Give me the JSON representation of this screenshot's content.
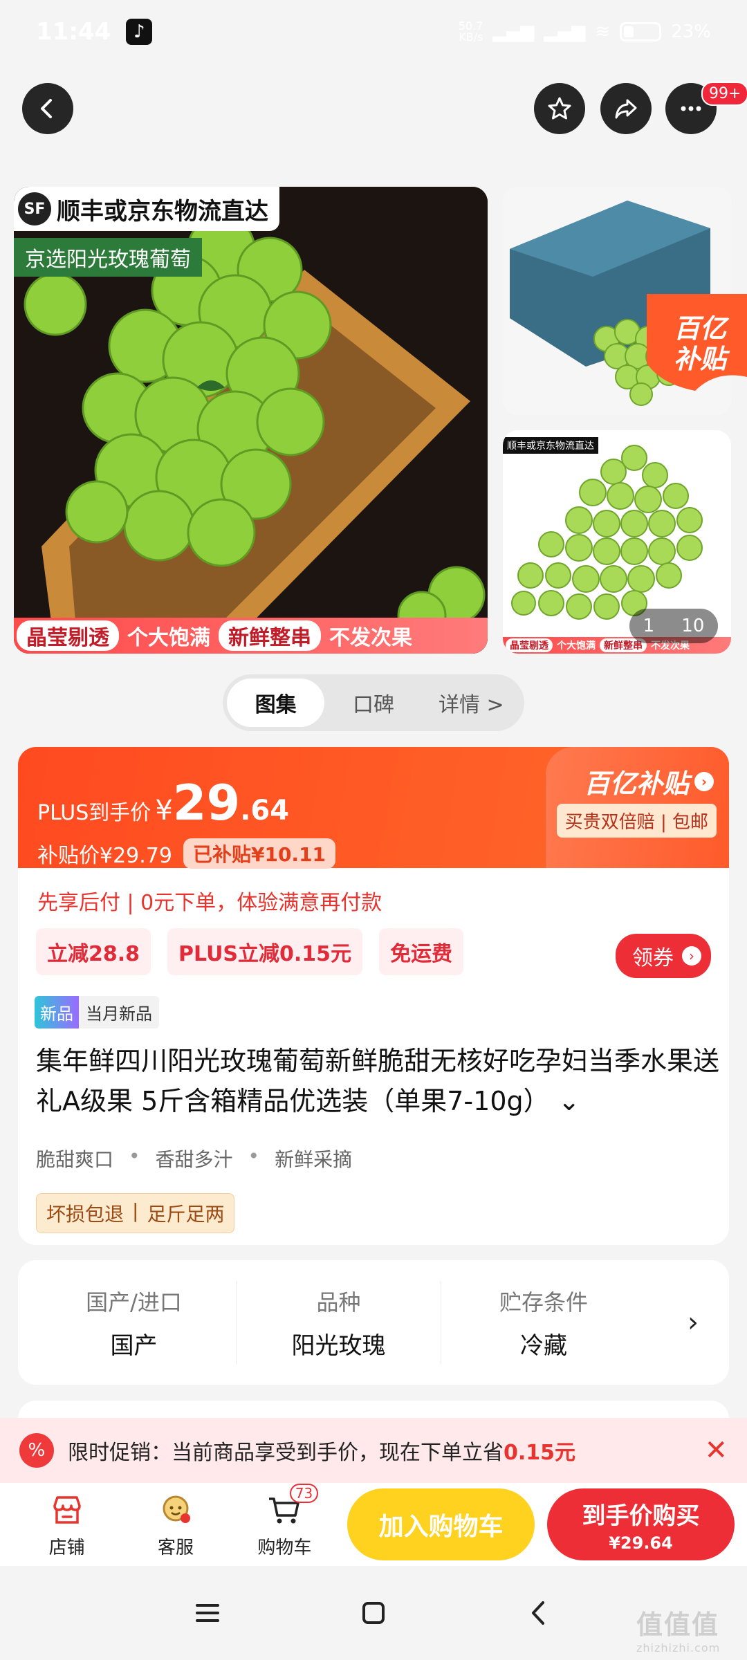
{
  "status_bar": {
    "time": "11:44",
    "net_up": "50.7",
    "net_unit": "KB/s",
    "battery": "23%"
  },
  "header": {
    "badge": "99+"
  },
  "gallery": {
    "sf_label": "顺丰或京东物流直达",
    "sf_logo": "SF",
    "variety_label": "京选阳光玫瑰葡萄",
    "strip": [
      "晶莹剔透",
      "个大饱满",
      "新鲜整串",
      "不发次果"
    ],
    "subsidy_brand": "百亿补贴",
    "counter_current": "1",
    "counter_total": "10"
  },
  "tabs": [
    {
      "label": "图集",
      "active": true
    },
    {
      "label": "口碑",
      "active": false
    },
    {
      "label": "详情 >",
      "active": false
    }
  ],
  "price": {
    "plus_label": "PLUS到手价",
    "currency": "¥",
    "integer": "29",
    "decimal": ".64",
    "subsidy_price_label": "补贴价¥29.79",
    "subsidized_tag": "已补贴¥10.11",
    "brand": "百亿补贴",
    "brand_sub": "买贵双倍赔 | 包邮"
  },
  "offers": {
    "pay_later": "先享后付 | 0元下单，体验满意再付款",
    "chips": [
      "立减28.8",
      "PLUS立减0.15元",
      "免运费"
    ],
    "get_coupon": "领券"
  },
  "product": {
    "new_tag": "新品",
    "new_tag_text": "当月新品",
    "title": "集年鲜四川阳光玫瑰葡萄新鲜脆甜无核好吃孕妇当季水果送礼A级果 5斤含箱精品优选装（单果7-10g）",
    "features": [
      "脆甜爽口",
      "香甜多汁",
      "新鲜采摘"
    ],
    "guarantees": [
      "坏损包退",
      "足斤足两"
    ]
  },
  "attributes": [
    {
      "key": "国产/进口",
      "value": "国产"
    },
    {
      "key": "品种",
      "value": "阳光玫瑰"
    },
    {
      "key": "贮存条件",
      "value": "冷藏"
    }
  ],
  "promo": {
    "icon": "%",
    "text": "限时促销：当前商品享受到手价，现在下单立省",
    "amount": "0.15元"
  },
  "bottom_bar": {
    "shop": "店铺",
    "service": "客服",
    "cart": "购物车",
    "cart_count": "73",
    "add_to_cart": "加入购物车",
    "buy_line1": "到手价购买",
    "buy_line2": "¥29.64"
  },
  "watermark": {
    "main": "值值值",
    "sub": "zhizhizhi.com"
  },
  "colors": {
    "accent": "#ee2e36",
    "orange": "#ff5226",
    "yellow": "#ffd21f",
    "grape": "#9bd64a"
  }
}
